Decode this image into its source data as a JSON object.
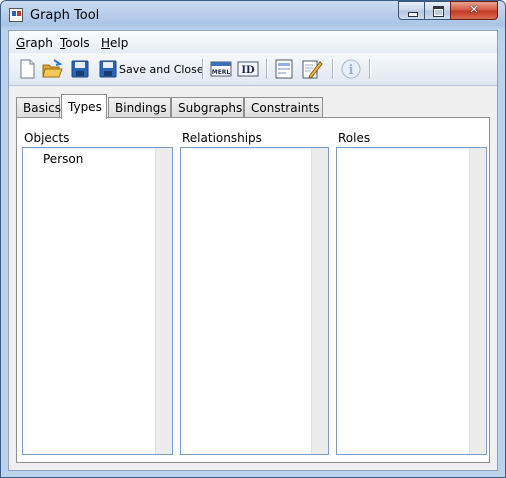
{
  "window": {
    "title": "Graph Tool",
    "minimize_icon": "minimize-icon",
    "maximize_icon": "maximize-icon",
    "close_glyph": "✕"
  },
  "menu": {
    "items": [
      {
        "label": "Graph",
        "mnemonic": "G",
        "rest": "raph"
      },
      {
        "label": "Tools",
        "mnemonic": "T",
        "rest": "ools"
      },
      {
        "label": "Help",
        "mnemonic": "H",
        "rest": "elp"
      }
    ]
  },
  "toolbar": {
    "icons": [
      "new-document-icon",
      "open-folder-icon",
      "save-icon",
      "save-and-close-icon",
      "merl-icon",
      "id-icon",
      "form-icon",
      "edit-icon",
      "info-icon"
    ],
    "save_and_close_label": "Save and Close",
    "merl_text": "MERL",
    "id_text": "ID",
    "info_text": "i"
  },
  "tabs": [
    {
      "label": "Basics",
      "active": false
    },
    {
      "label": "Types",
      "active": true
    },
    {
      "label": "Bindings",
      "active": false
    },
    {
      "label": "Subgraphs",
      "active": false
    },
    {
      "label": "Constraints",
      "active": false
    }
  ],
  "panels": {
    "objects": {
      "label": "Objects",
      "items": [
        "Person"
      ]
    },
    "relationships": {
      "label": "Relationships",
      "items": []
    },
    "roles": {
      "label": "Roles",
      "items": []
    }
  },
  "colors": {
    "accent": "#7a9cc5",
    "title_bar": "#bcd3ee",
    "close_button": "#c1371f"
  }
}
